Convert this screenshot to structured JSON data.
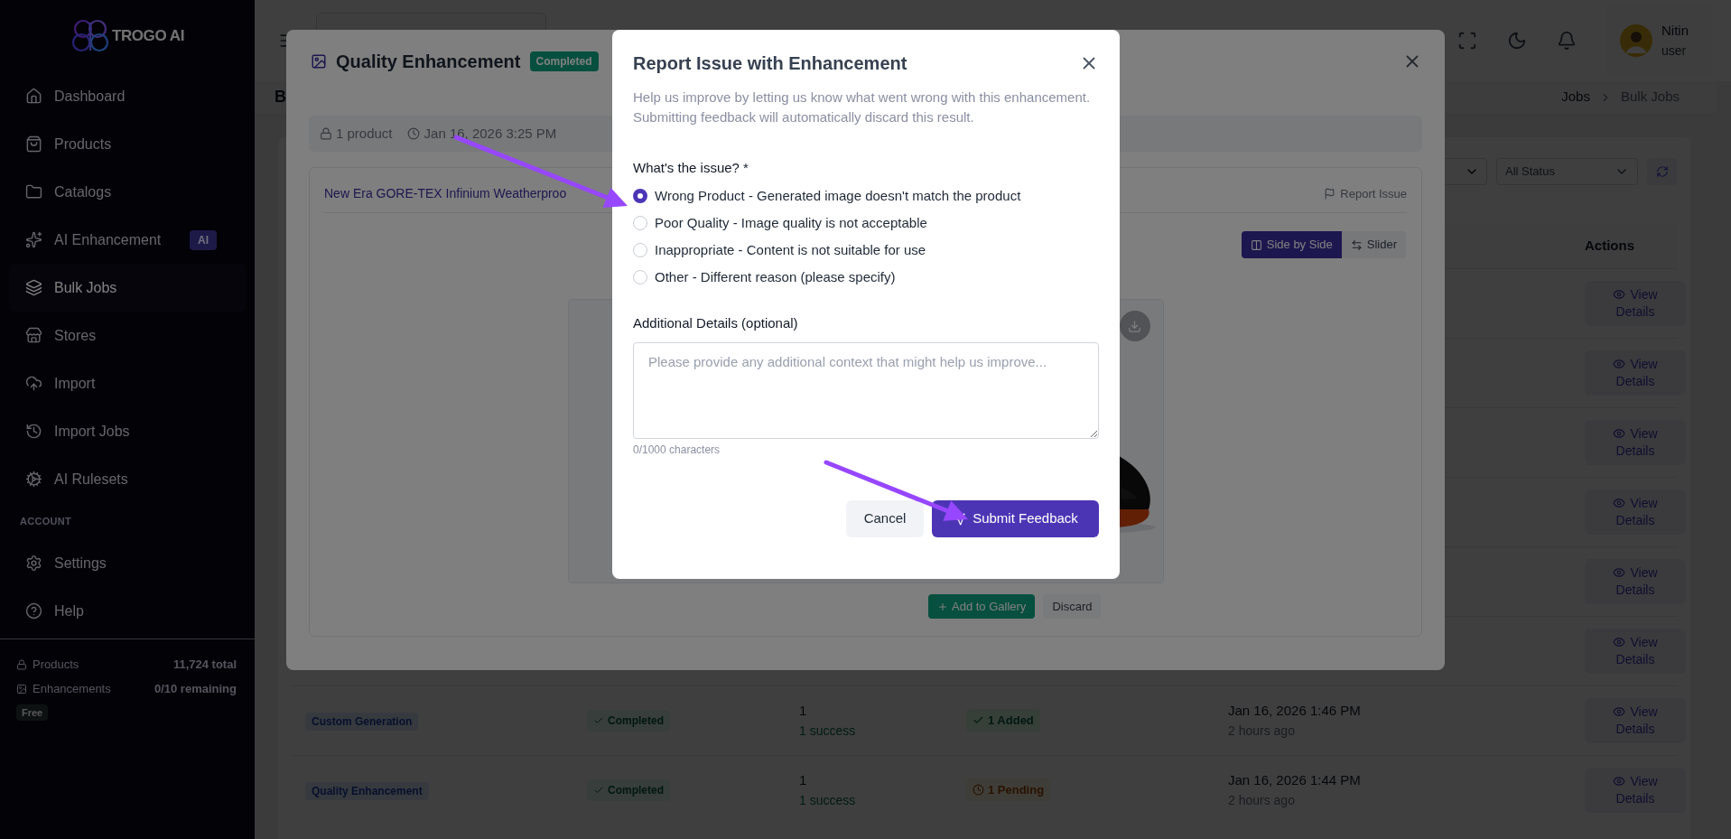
{
  "sidebar": {
    "logo": "TROGO AI",
    "items": [
      {
        "label": "Dashboard",
        "selected": false
      },
      {
        "label": "Products",
        "selected": false
      },
      {
        "label": "Catalogs",
        "selected": false
      },
      {
        "label": "AI Enhancement",
        "selected": false,
        "badge": "AI"
      },
      {
        "label": "Bulk Jobs",
        "selected": true
      },
      {
        "label": "Stores",
        "selected": false
      },
      {
        "label": "Import",
        "selected": false
      },
      {
        "label": "Import Jobs",
        "selected": false
      },
      {
        "label": "AI Rulesets",
        "selected": false
      }
    ],
    "section": "ACCOUNT",
    "account_items": [
      {
        "label": "Settings",
        "selected": false
      },
      {
        "label": "Help",
        "selected": false
      }
    ],
    "usage": [
      {
        "label": "Products",
        "value": "11,724 total"
      },
      {
        "label": "Enhancements",
        "value": "0/10 remaining"
      }
    ],
    "plan": "Free"
  },
  "header": {
    "user": {
      "name": "Nitin",
      "role": "user"
    }
  },
  "page": {
    "title": "B",
    "breadcrumb": [
      "Jobs",
      "Bulk Jobs"
    ]
  },
  "filters": {
    "status": "All Status"
  },
  "table": {
    "columns": [
      {
        "label": "Actions"
      }
    ],
    "rows": [
      {
        "action": "View Details"
      },
      {
        "action": "View Details"
      },
      {
        "action": "View Details"
      },
      {
        "action": "View Details"
      },
      {
        "action": "View Details"
      },
      {
        "action": "View Details"
      },
      {
        "type": "Custom Generation",
        "status": "Completed",
        "count": "1",
        "result": "1 success",
        "gallery": {
          "kind": "added",
          "label": "1 Added"
        },
        "date": "Jan 16, 2026 1:46 PM",
        "ago": "2 hours ago",
        "action": "View Details"
      },
      {
        "type": "Quality Enhancement",
        "status": "Completed",
        "count": "1",
        "result": "1 success",
        "gallery": {
          "kind": "pending",
          "label": "1 Pending"
        },
        "date": "Jan 16, 2026 1:44 PM",
        "ago": "2 hours ago",
        "action": "View Details"
      }
    ]
  },
  "job_modal": {
    "title": "Quality Enhancement",
    "status": "Completed",
    "products": "1 product",
    "created": "Jan 16, 2026 3:25 PM",
    "product": {
      "name": "New Era GORE-TEX Infinium Weatherproo",
      "report": "Report Issue",
      "views": [
        {
          "label": "Side by Side",
          "selected": true
        },
        {
          "label": "Slider",
          "selected": false
        }
      ],
      "actions": [
        {
          "label": "Add to Gallery",
          "kind": "primary"
        },
        {
          "label": "Discard",
          "kind": "secondary"
        }
      ]
    }
  },
  "report_modal": {
    "title": "Report Issue with Enhancement",
    "description": "Help us improve by letting us know what went wrong with this enhancement. Submitting feedback will automatically discard this result.",
    "question": "What's the issue? *",
    "options": [
      {
        "label": "Wrong Product - Generated image doesn't match the product",
        "selected": true
      },
      {
        "label": "Poor Quality - Image quality is not acceptable",
        "selected": false
      },
      {
        "label": "Inappropriate - Content is not suitable for use",
        "selected": false
      },
      {
        "label": "Other - Different reason (please specify)",
        "selected": false
      }
    ],
    "details_label": "Additional Details (optional)",
    "details": {
      "placeholder": "Please provide any additional context that might help us improve..."
    },
    "counter": "0/1000 characters",
    "buttons": [
      {
        "label": "Cancel",
        "kind": "secondary"
      },
      {
        "label": "Submit Feedback",
        "kind": "primary"
      }
    ]
  }
}
